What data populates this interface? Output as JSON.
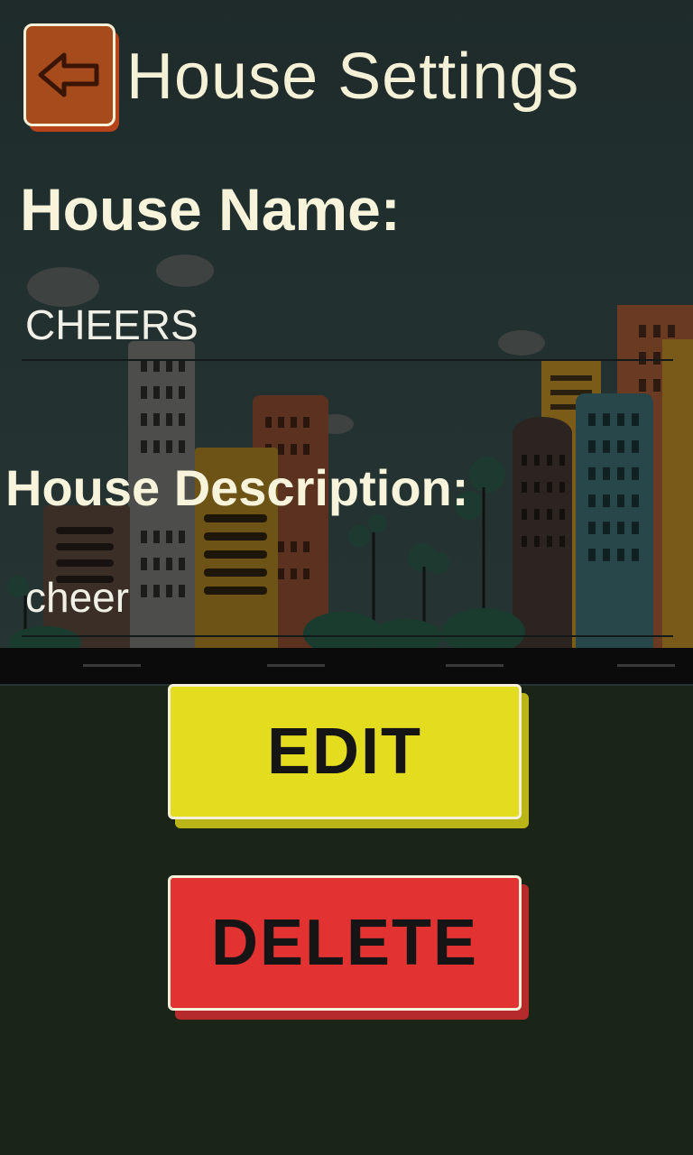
{
  "header": {
    "title": "House Settings",
    "back_icon": "back-arrow-icon"
  },
  "form": {
    "name_label": "House Name:",
    "name_value": "CHEERS",
    "description_label": "House Description:",
    "description_value": "cheer"
  },
  "actions": {
    "edit_label": "EDIT",
    "delete_label": "DELETE"
  },
  "colors": {
    "edit": "#e4dd1f",
    "delete": "#e33232",
    "back_button": "#a54b1c",
    "background": "#1b2517"
  }
}
